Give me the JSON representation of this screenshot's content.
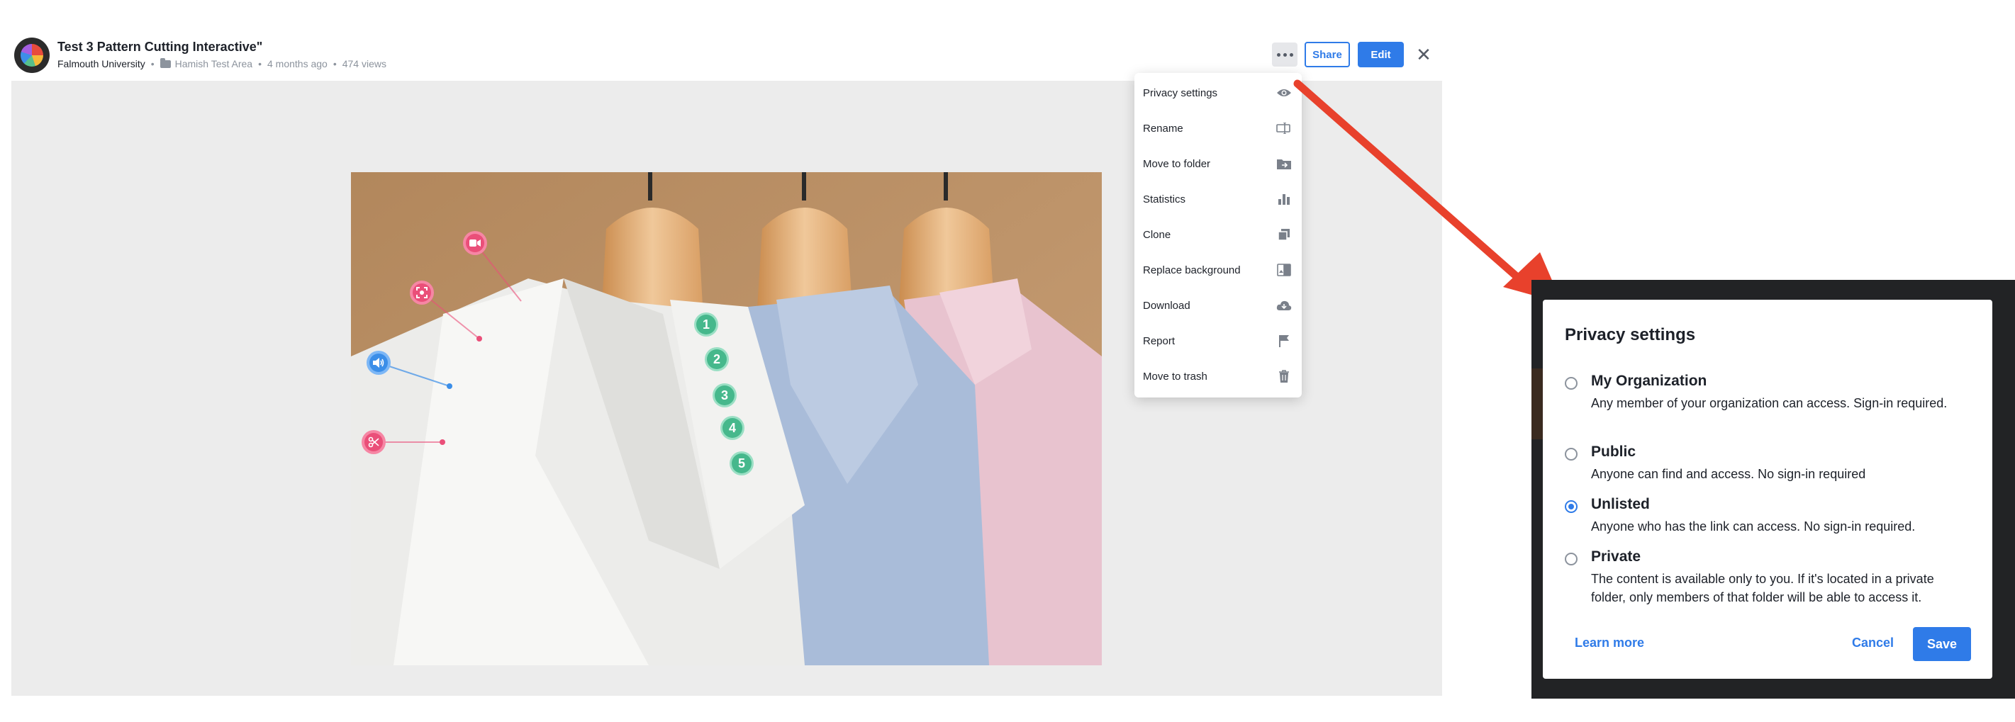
{
  "header": {
    "title": "Test 3 Pattern Cutting Interactive\"",
    "organization": "Falmouth University",
    "folder": "Hamish Test Area",
    "time_ago": "4 months ago",
    "views": "474 views",
    "share_label": "Share",
    "edit_label": "Edit"
  },
  "hotspots": {
    "numbers": [
      "1",
      "2",
      "3",
      "4",
      "5"
    ],
    "icons": [
      "video-icon",
      "focus-icon",
      "audio-icon",
      "scissors-icon"
    ]
  },
  "menu": {
    "items": [
      {
        "label": "Privacy settings",
        "icon": "eye-icon"
      },
      {
        "label": "Rename",
        "icon": "rename-icon"
      },
      {
        "label": "Move to folder",
        "icon": "move-folder-icon"
      },
      {
        "label": "Statistics",
        "icon": "bar-chart-icon"
      },
      {
        "label": "Clone",
        "icon": "clone-icon"
      },
      {
        "label": "Replace background",
        "icon": "replace-image-icon"
      },
      {
        "label": "Download",
        "icon": "cloud-download-icon"
      },
      {
        "label": "Report",
        "icon": "flag-icon"
      },
      {
        "label": "Move to trash",
        "icon": "trash-icon"
      }
    ]
  },
  "privacy": {
    "title": "Privacy settings",
    "options": [
      {
        "title": "My Organization",
        "desc": "Any member of your organization can access. Sign-in required.",
        "selected": false
      },
      {
        "title": "Public",
        "desc": "Anyone can find and access. No sign-in required",
        "selected": false
      },
      {
        "title": "Unlisted",
        "desc": "Anyone who has the link can access. No sign-in required.",
        "selected": true
      },
      {
        "title": "Private",
        "desc": "The content is available only to you. If it's located in a private folder, only members of that folder will be able to access it.",
        "selected": false
      }
    ],
    "learn_more": "Learn more",
    "cancel": "Cancel",
    "save": "Save"
  },
  "colors": {
    "accent": "#2f7be8",
    "hotspot_pink": "#ea4f79",
    "hotspot_green": "#46b88c",
    "annotation_arrow": "#e8412c"
  }
}
